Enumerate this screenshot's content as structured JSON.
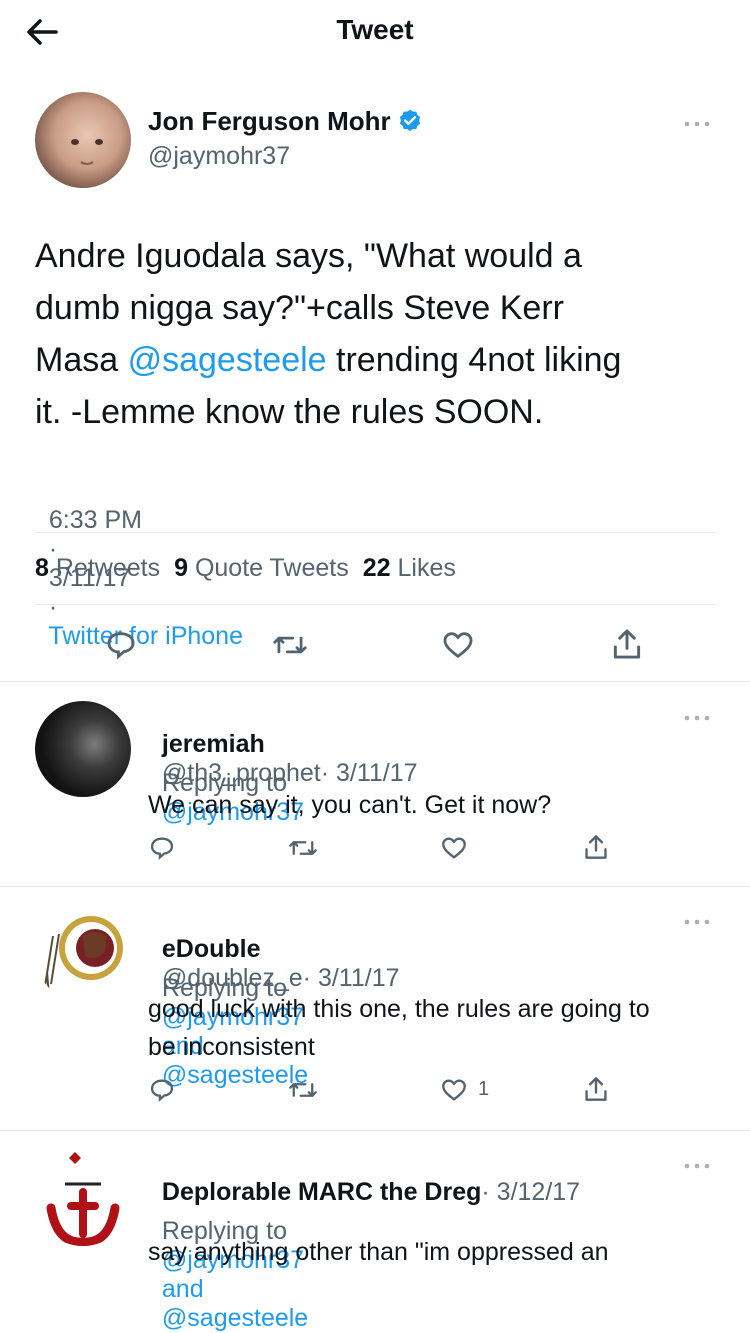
{
  "header": {
    "title": "Tweet"
  },
  "tweet": {
    "author_name": "Jon Ferguson Mohr",
    "author_handle": "@jaymohr37",
    "text_line1": "Andre Iguodala says, \"What would a",
    "text_line2": "dumb nigga say?\"+calls Steve Kerr",
    "text_line3_pre": "Masa ",
    "text_line3_mention": "@sagesteele",
    "text_line3_post": " trending 4not liking",
    "text_line4": "it. -Lemme know the rules SOON.",
    "time": "6:33 PM",
    "date": "3/11/17",
    "sep": "·",
    "source": "Twitter for iPhone",
    "retweets_count": "8",
    "retweets_label": "Retweets",
    "quotes_count": "9",
    "quotes_label": "Quote Tweets",
    "likes_count": "22",
    "likes_label": "Likes"
  },
  "replies": [
    {
      "name": "jeremiah",
      "handle": "@th3_prophet",
      "date": "· 3/11/17",
      "replying_prefix": "Replying to",
      "replying_to": "@jaymohr37",
      "replying_and": "",
      "replying_to2": "",
      "text_line1": "We can say it, you can't. Get it now?",
      "text_line2": "",
      "like_count": ""
    },
    {
      "name": "eDouble",
      "handle": "@doublez_e",
      "date": "· 3/11/17",
      "replying_prefix": "Replying to",
      "replying_to": "@jaymohr37",
      "replying_and": "and",
      "replying_to2": "@sagesteele",
      "text_line1": "good luck with this one, the rules are going to",
      "text_line2": "be inconsistent",
      "like_count": "1"
    },
    {
      "name": "Deplorable MARC the Dreg",
      "handle": "",
      "date": "· 3/12/17",
      "replying_prefix": "Replying to",
      "replying_to": "@jaymohr37",
      "replying_and": "and",
      "replying_to2": "@sagesteele",
      "text_line1": "say anything other than \"im oppressed an",
      "text_line2": "",
      "like_count": ""
    }
  ],
  "colors": {
    "link": "#1d9bf0",
    "muted": "#536471",
    "text": "#0f1419",
    "verified": "#1d9bf0"
  }
}
